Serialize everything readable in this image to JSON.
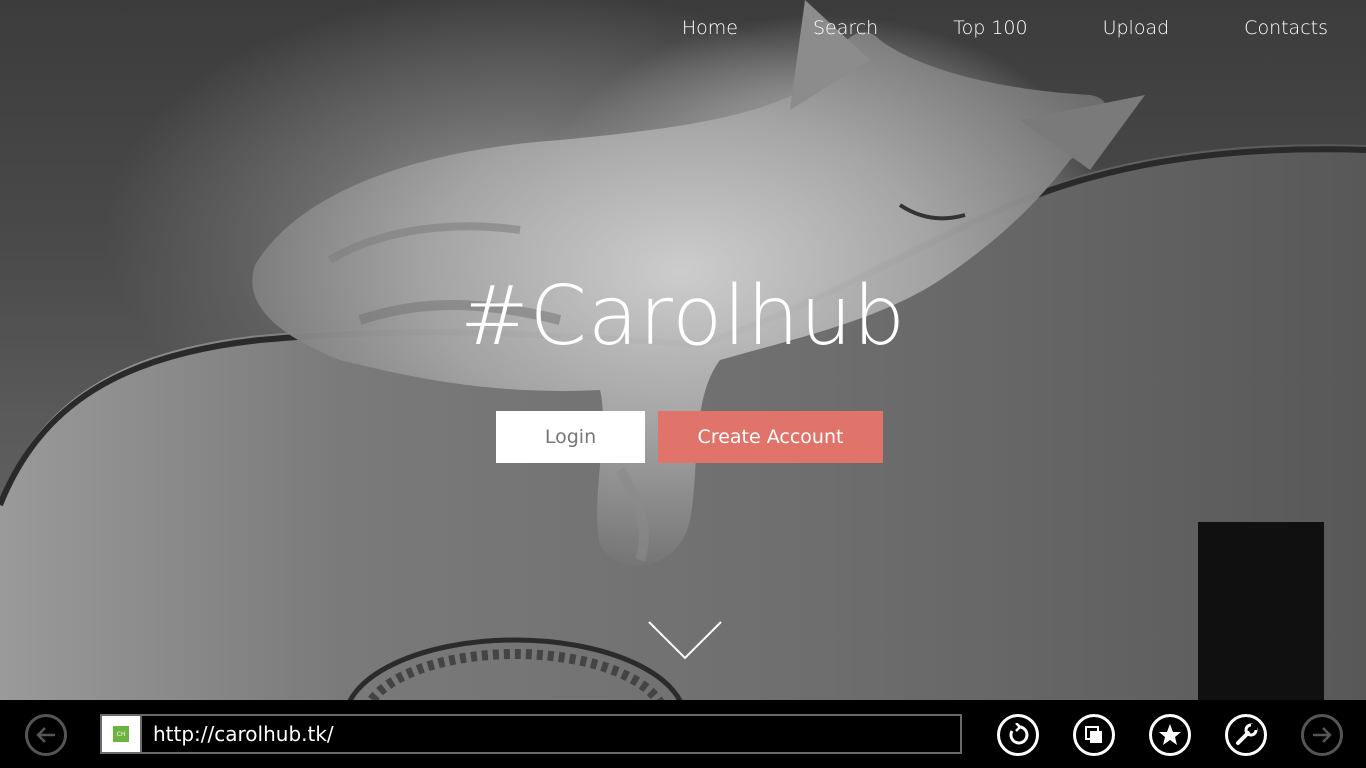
{
  "nav": {
    "items": [
      "Home",
      "Search",
      "Top 100",
      "Upload",
      "Contacts"
    ]
  },
  "hero": {
    "title": "#Carolhub",
    "login_label": "Login",
    "create_label": "Create Account",
    "accent": "#e0736a"
  },
  "browser": {
    "url": "http://carolhub.tk/",
    "favicon_text": "CH",
    "icons": [
      "back-icon",
      "refresh-icon",
      "tabs-icon",
      "favorites-icon",
      "tools-icon",
      "forward-icon"
    ]
  }
}
